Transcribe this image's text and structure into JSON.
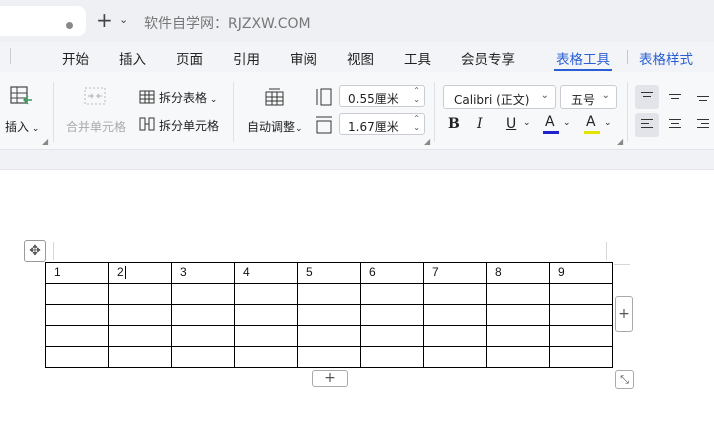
{
  "titlebar": {
    "doc_title": "软件自学网：RJZXW.COM",
    "new_tab_symbol": "+",
    "new_tab_caret": "⌄"
  },
  "menu": {
    "items": [
      {
        "label": "开始"
      },
      {
        "label": "插入"
      },
      {
        "label": "页面"
      },
      {
        "label": "引用"
      },
      {
        "label": "审阅"
      },
      {
        "label": "视图"
      },
      {
        "label": "工具"
      },
      {
        "label": "会员专享"
      },
      {
        "label": "表格工具",
        "active": true
      },
      {
        "label": "表格样式",
        "active": true
      }
    ],
    "accent_color": "#2a5fd4"
  },
  "ribbon": {
    "insert_label": "插入",
    "merge_cells_label": "合并单元格",
    "split_table_label": "拆分表格",
    "split_cells_label": "拆分单元格",
    "auto_adjust_label": "自动调整",
    "width_value": "0.55厘米",
    "height_value": "1.67厘米",
    "font_name": "Calibri (正文)",
    "font_size": "五号",
    "bold": "B",
    "italic": "I",
    "underline": "U",
    "font_color_letter": "A",
    "highlight_letter": "A"
  },
  "table": {
    "rows": [
      [
        "1",
        "2",
        "3",
        "4",
        "5",
        "6",
        "7",
        "8",
        "9"
      ],
      [
        "",
        "",
        "",
        "",
        "",
        "",
        "",
        "",
        ""
      ],
      [
        "",
        "",
        "",
        "",
        "",
        "",
        "",
        "",
        ""
      ],
      [
        "",
        "",
        "",
        "",
        "",
        "",
        "",
        "",
        ""
      ],
      [
        "",
        "",
        "",
        "",
        "",
        "",
        "",
        "",
        ""
      ]
    ],
    "add_symbol": "+"
  }
}
